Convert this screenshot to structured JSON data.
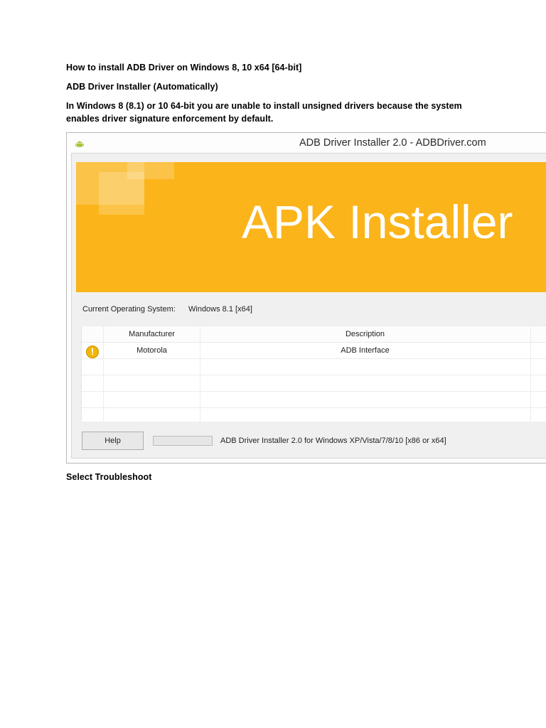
{
  "document": {
    "heading": "How to install ADB Driver on Windows 8, 10 x64 [64-bit]",
    "subheading": "ADB Driver Installer (Automatically)",
    "paragraph_line1": "In Windows 8 (8.1) or 10 64-bit you are unable to install unsigned drivers because the system",
    "paragraph_line2": "enables driver signature enforcement by default.",
    "footer_text": "Select Troubleshoot"
  },
  "window": {
    "title": "ADB Driver Installer 2.0 - ADBDriver.com",
    "icon": "android-icon",
    "banner_title": "APK Installer",
    "banner_color": "#fbb51a",
    "os_label": "Current Operating System:",
    "os_value": "Windows 8.1  [x64]",
    "table": {
      "columns": [
        "",
        "Manufacturer",
        "Description"
      ],
      "rows": [
        {
          "status_icon": "warning-icon",
          "manufacturer": "Motorola",
          "description": "ADB Interface"
        }
      ]
    },
    "help_label": "Help",
    "progress": 0,
    "status_text": "ADB Driver Installer 2.0 for Windows XP/Vista/7/8/10 [x86 or x64]"
  }
}
